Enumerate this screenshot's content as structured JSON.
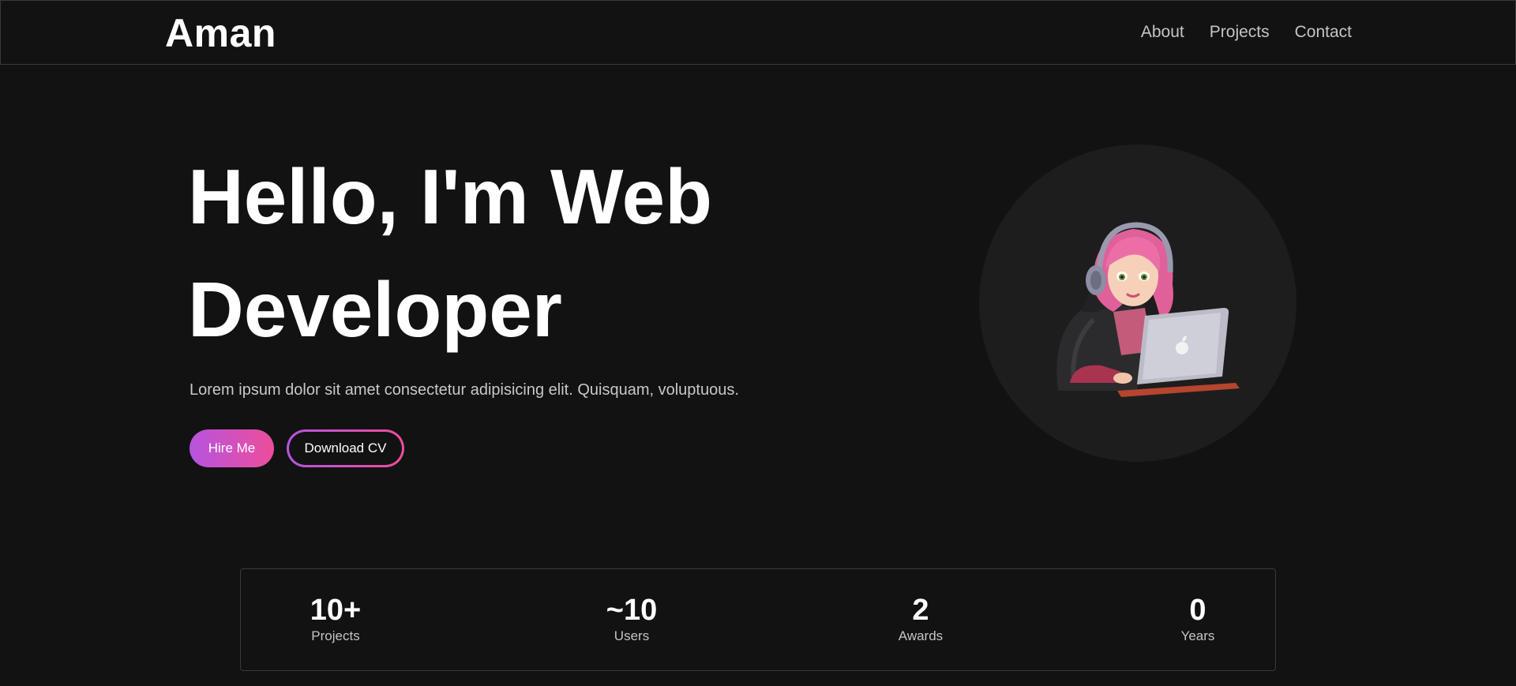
{
  "nav": {
    "brand": "Aman",
    "links": [
      "About",
      "Projects",
      "Contact"
    ]
  },
  "hero": {
    "title_line1": "Hello, I'm Web",
    "title_line2": "Developer",
    "subtitle": "Lorem ipsum dolor sit amet consectetur adipisicing elit. Quisquam, voluptuous.",
    "hire_button": "Hire Me",
    "cv_button": "Download CV"
  },
  "avatar": {
    "icon": "developer-girl-avatar-icon"
  },
  "stats": [
    {
      "value": "10+",
      "label": "Projects"
    },
    {
      "value": "~10",
      "label": "Users"
    },
    {
      "value": "2",
      "label": "Awards"
    },
    {
      "value": "0",
      "label": "Years"
    }
  ],
  "colors": {
    "background": "#121212",
    "accent_start": "#b654e0",
    "accent_end": "#ec4e9a",
    "border": "#3a3a3a"
  }
}
